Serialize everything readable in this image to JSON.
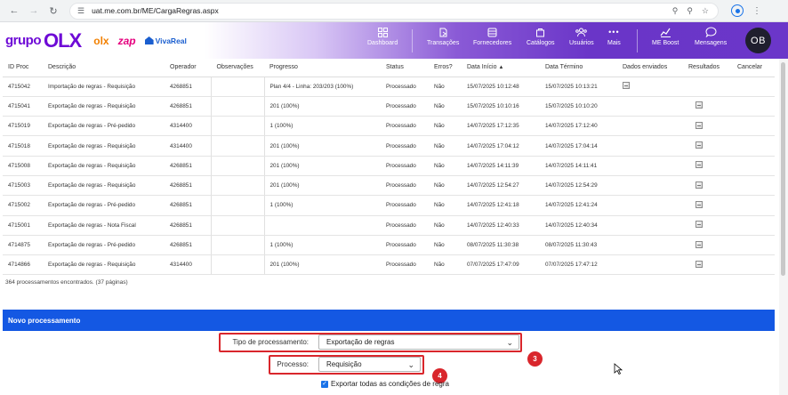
{
  "browser": {
    "url": "uat.me.com.br/ME/CargaRegras.aspx",
    "back_icon": "arrow-left-icon",
    "forward_icon": "arrow-right-icon",
    "reload_icon": "reload-icon"
  },
  "brand": {
    "grupo": "grupo",
    "olx": "OLX",
    "olx_small": "olx",
    "zap": "zap",
    "vivareal": "VivaReal"
  },
  "topnav": {
    "items": [
      {
        "label": "Dashboard",
        "icon": "dashboard-icon"
      },
      {
        "label": "Transações",
        "icon": "transactions-icon"
      },
      {
        "label": "Fornecedores",
        "icon": "suppliers-icon"
      },
      {
        "label": "Catálogos",
        "icon": "catalog-icon"
      },
      {
        "label": "Usuários",
        "icon": "users-icon"
      },
      {
        "label": "Mais",
        "icon": "more-dots-icon"
      },
      {
        "label": "ME Boost",
        "icon": "chart-icon"
      },
      {
        "label": "Mensagens",
        "icon": "chat-icon"
      }
    ],
    "avatar": "OB"
  },
  "table": {
    "columns": [
      "ID Proc",
      "Descrição",
      "Operador",
      "Observações",
      "Progresso",
      "Status",
      "Erros?",
      "Data Início",
      "Data Término",
      "Dados enviados",
      "Resultados",
      "Cancelar"
    ],
    "rows": [
      [
        "4715042",
        "Importação de regras - Requisição",
        "4268851",
        "",
        "Plan 4/4 - Linha: 203/203 (100%)",
        "Processado",
        "Não",
        "15/07/2025 10:12:48",
        "15/07/2025 10:13:21"
      ],
      [
        "4715041",
        "Exportação de regras - Requisição",
        "4268851",
        "",
        "201 (100%)",
        "Processado",
        "Não",
        "15/07/2025 10:10:16",
        "15/07/2025 10:10:20"
      ],
      [
        "4715019",
        "Exportação de regras - Pré-pedido",
        "4314400",
        "",
        "1 (100%)",
        "Processado",
        "Não",
        "14/07/2025 17:12:35",
        "14/07/2025 17:12:40"
      ],
      [
        "4715018",
        "Exportação de regras - Requisição",
        "4314400",
        "",
        "201 (100%)",
        "Processado",
        "Não",
        "14/07/2025 17:04:12",
        "14/07/2025 17:04:14"
      ],
      [
        "4715008",
        "Exportação de regras - Requisição",
        "4268851",
        "",
        "201 (100%)",
        "Processado",
        "Não",
        "14/07/2025 14:11:39",
        "14/07/2025 14:11:41"
      ],
      [
        "4715003",
        "Exportação de regras - Requisição",
        "4268851",
        "",
        "201 (100%)",
        "Processado",
        "Não",
        "14/07/2025 12:54:27",
        "14/07/2025 12:54:29"
      ],
      [
        "4715002",
        "Exportação de regras - Pré-pedido",
        "4268851",
        "",
        "1 (100%)",
        "Processado",
        "Não",
        "14/07/2025 12:41:18",
        "14/07/2025 12:41:24"
      ],
      [
        "4715001",
        "Exportação de regras - Nota Fiscal",
        "4268851",
        "",
        "",
        "Processado",
        "Não",
        "14/07/2025 12:40:33",
        "14/07/2025 12:40:34"
      ],
      [
        "4714875",
        "Exportação de regras - Pré-pedido",
        "4268851",
        "",
        "1 (100%)",
        "Processado",
        "Não",
        "08/07/2025 11:30:38",
        "08/07/2025 11:30:43"
      ],
      [
        "4714866",
        "Exportação de regras - Requisição",
        "4314400",
        "",
        "201 (100%)",
        "Processado",
        "Não",
        "07/07/2025 17:47:09",
        "07/07/2025 17:47:12"
      ]
    ],
    "count_text": "364 processamentos encontrados. (37 páginas)"
  },
  "novo": {
    "title": "Novo processamento",
    "tipo_label": "Tipo de processamento:",
    "tipo_value": "Exportação de regras",
    "processo_label": "Processo:",
    "processo_value": "Requisição",
    "checkbox_label": "Exportar todas as condições de regra",
    "checkbox_checked": true,
    "badge_3": "3",
    "badge_4": "4"
  },
  "colors": {
    "accent_purple": "#6e0ad6",
    "section_blue": "#1458e3",
    "highlight_red": "#d9262c"
  }
}
